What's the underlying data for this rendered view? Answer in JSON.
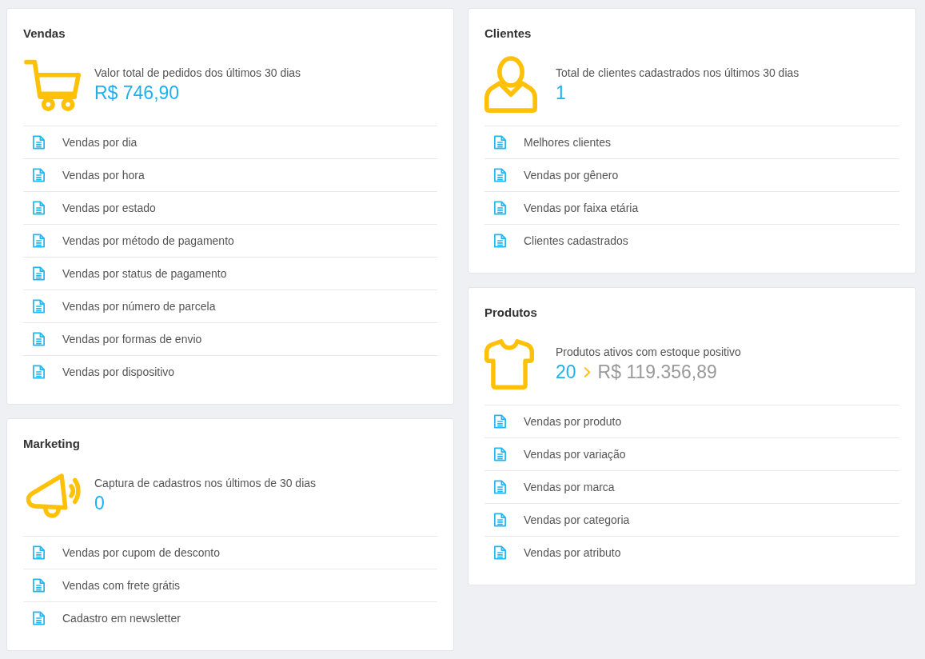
{
  "columns": [
    {
      "cards": [
        {
          "title": "Vendas",
          "kind": "cart",
          "summary": {
            "label": "Valor total de pedidos dos últimos 30 dias",
            "value": "R$ 746,90"
          },
          "reports": [
            "Vendas por dia",
            "Vendas por hora",
            "Vendas por estado",
            "Vendas por método de pagamento",
            "Vendas por status de pagamento",
            "Vendas por número de parcela",
            "Vendas por formas de envio",
            "Vendas por dispositivo"
          ]
        },
        {
          "title": "Marketing",
          "kind": "megaphone",
          "summary": {
            "label": "Captura de cadastros nos últimos de 30 dias",
            "value": "0"
          },
          "reports": [
            "Vendas por cupom de desconto",
            "Vendas com frete grátis",
            "Cadastro em newsletter"
          ]
        }
      ]
    },
    {
      "cards": [
        {
          "title": "Clientes",
          "kind": "person",
          "summary": {
            "label": "Total de clientes cadastrados nos últimos 30 dias",
            "value": "1"
          },
          "reports": [
            "Melhores clientes",
            "Vendas por gênero",
            "Vendas por faixa etária",
            "Clientes cadastrados"
          ]
        },
        {
          "title": "Produtos",
          "kind": "shirt",
          "summary": {
            "label": "Produtos ativos com estoque positivo",
            "value": "20",
            "secondary_value": "R$ 119.356,89"
          },
          "reports": [
            "Vendas por produto",
            "Vendas por variação",
            "Vendas por marca",
            "Vendas por categoria",
            "Vendas por atributo"
          ]
        }
      ]
    }
  ]
}
